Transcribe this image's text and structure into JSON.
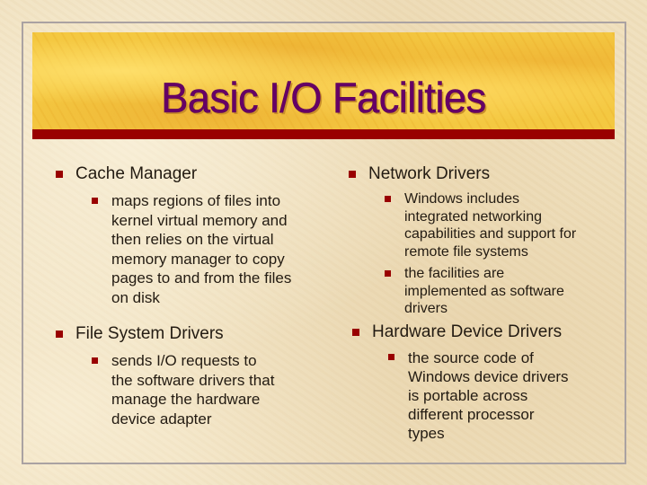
{
  "slide": {
    "title": "Basic I/O Facilities",
    "colors": {
      "title_text": "#660066",
      "title_shadow": "#c98f2a",
      "banner": "#f3c53c",
      "rule": "#990000",
      "bullet": "#990000",
      "body_text": "#231b12",
      "background": "#efdfbc",
      "frame_border": "#aaa2a2"
    },
    "bullet_icon": "square-bullet-icon",
    "left_column": [
      {
        "heading": "Cache Manager",
        "points": [
          "maps regions of files into\nkernel virtual memory and\nthen relies on the virtual\nmemory manager to copy\npages to and from the files\non disk"
        ]
      },
      {
        "heading": "File System Drivers",
        "points": [
          "sends I/O requests to\nthe software drivers that\nmanage the hardware\ndevice adapter"
        ]
      }
    ],
    "right_column": [
      {
        "heading": "Network Drivers",
        "points": [
          "Windows includes\nintegrated networking\ncapabilities and support for\nremote file systems",
          "the facilities are\nimplemented as software\ndrivers"
        ]
      },
      {
        "heading": "Hardware Device Drivers",
        "points": [
          "the source code of\nWindows device drivers\nis portable across\ndifferent processor\ntypes"
        ]
      }
    ]
  }
}
